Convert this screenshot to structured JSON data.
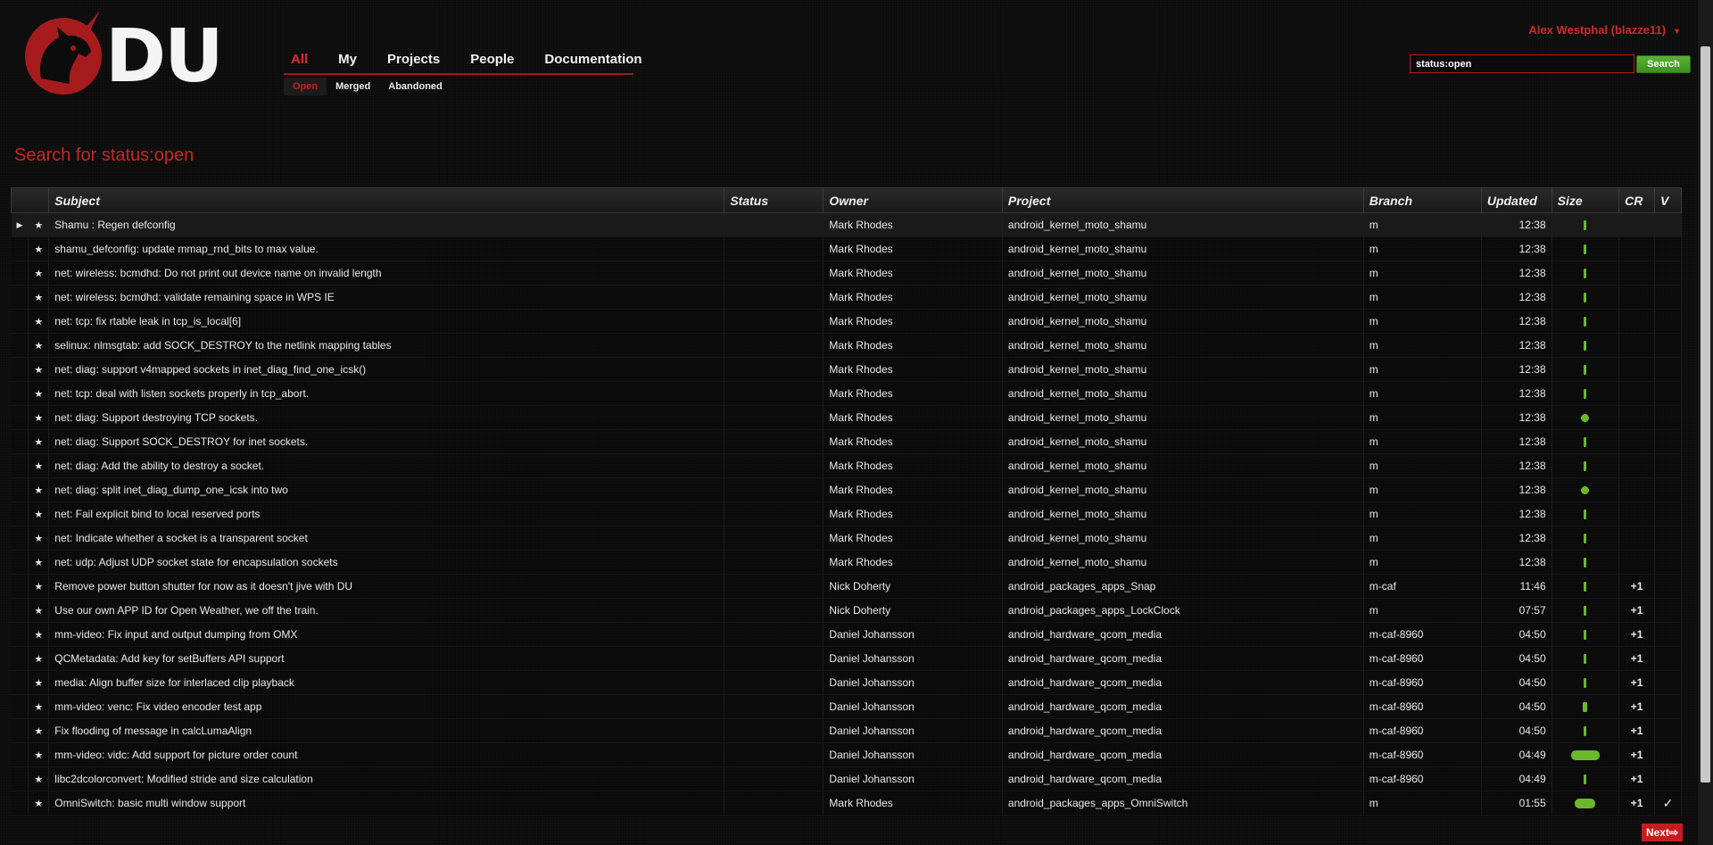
{
  "logo": {
    "text": "DU"
  },
  "nav": {
    "tabs": [
      {
        "label": "All",
        "active": true
      },
      {
        "label": "My",
        "active": false
      },
      {
        "label": "Projects",
        "active": false
      },
      {
        "label": "People",
        "active": false
      },
      {
        "label": "Documentation",
        "active": false
      }
    ],
    "sub": [
      {
        "label": "Open",
        "active": true
      },
      {
        "label": "Merged",
        "active": false
      },
      {
        "label": "Abandoned",
        "active": false
      }
    ]
  },
  "user": {
    "name": "Alex Westphal (blazze11)"
  },
  "search": {
    "value": "status:open",
    "button": "Search"
  },
  "page_title": "Search for status:open",
  "columns": [
    "Subject",
    "Status",
    "Owner",
    "Project",
    "Branch",
    "Updated",
    "Size",
    "CR",
    "V"
  ],
  "rows": [
    {
      "subject": "Shamu : Regen defconfig",
      "status": "",
      "owner": "Mark Rhodes",
      "project": "android_kernel_moto_shamu",
      "branch": "m",
      "updated": "12:38",
      "size": "tiny",
      "cr": "",
      "v": ""
    },
    {
      "subject": "shamu_defconfig: update mmap_rnd_bits to max value.",
      "status": "",
      "owner": "Mark Rhodes",
      "project": "android_kernel_moto_shamu",
      "branch": "m",
      "updated": "12:38",
      "size": "tiny",
      "cr": "",
      "v": ""
    },
    {
      "subject": "net: wireless: bcmdhd: Do not print out device name on invalid length",
      "status": "",
      "owner": "Mark Rhodes",
      "project": "android_kernel_moto_shamu",
      "branch": "m",
      "updated": "12:38",
      "size": "tiny",
      "cr": "",
      "v": ""
    },
    {
      "subject": "net: wireless: bcmdhd: validate remaining space in WPS IE",
      "status": "",
      "owner": "Mark Rhodes",
      "project": "android_kernel_moto_shamu",
      "branch": "m",
      "updated": "12:38",
      "size": "tiny",
      "cr": "",
      "v": ""
    },
    {
      "subject": "net: tcp: fix rtable leak in tcp_is_local[6]",
      "status": "",
      "owner": "Mark Rhodes",
      "project": "android_kernel_moto_shamu",
      "branch": "m",
      "updated": "12:38",
      "size": "tiny",
      "cr": "",
      "v": ""
    },
    {
      "subject": "selinux: nlmsgtab: add SOCK_DESTROY to the netlink mapping tables",
      "status": "",
      "owner": "Mark Rhodes",
      "project": "android_kernel_moto_shamu",
      "branch": "m",
      "updated": "12:38",
      "size": "tiny",
      "cr": "",
      "v": ""
    },
    {
      "subject": "net: diag: support v4mapped sockets in inet_diag_find_one_icsk()",
      "status": "",
      "owner": "Mark Rhodes",
      "project": "android_kernel_moto_shamu",
      "branch": "m",
      "updated": "12:38",
      "size": "tiny",
      "cr": "",
      "v": ""
    },
    {
      "subject": "net: tcp: deal with listen sockets properly in tcp_abort.",
      "status": "",
      "owner": "Mark Rhodes",
      "project": "android_kernel_moto_shamu",
      "branch": "m",
      "updated": "12:38",
      "size": "tiny",
      "cr": "",
      "v": ""
    },
    {
      "subject": "net: diag: Support destroying TCP sockets.",
      "status": "",
      "owner": "Mark Rhodes",
      "project": "android_kernel_moto_shamu",
      "branch": "m",
      "updated": "12:38",
      "size": "dot",
      "cr": "",
      "v": ""
    },
    {
      "subject": "net: diag: Support SOCK_DESTROY for inet sockets.",
      "status": "",
      "owner": "Mark Rhodes",
      "project": "android_kernel_moto_shamu",
      "branch": "m",
      "updated": "12:38",
      "size": "tiny",
      "cr": "",
      "v": ""
    },
    {
      "subject": "net: diag: Add the ability to destroy a socket.",
      "status": "",
      "owner": "Mark Rhodes",
      "project": "android_kernel_moto_shamu",
      "branch": "m",
      "updated": "12:38",
      "size": "tiny",
      "cr": "",
      "v": ""
    },
    {
      "subject": "net: diag: split inet_diag_dump_one_icsk into two",
      "status": "",
      "owner": "Mark Rhodes",
      "project": "android_kernel_moto_shamu",
      "branch": "m",
      "updated": "12:38",
      "size": "dot",
      "cr": "",
      "v": ""
    },
    {
      "subject": "net: Fail explicit bind to local reserved ports",
      "status": "",
      "owner": "Mark Rhodes",
      "project": "android_kernel_moto_shamu",
      "branch": "m",
      "updated": "12:38",
      "size": "tiny",
      "cr": "",
      "v": ""
    },
    {
      "subject": "net: Indicate whether a socket is a transparent socket",
      "status": "",
      "owner": "Mark Rhodes",
      "project": "android_kernel_moto_shamu",
      "branch": "m",
      "updated": "12:38",
      "size": "tiny",
      "cr": "",
      "v": ""
    },
    {
      "subject": "net: udp: Adjust UDP socket state for encapsulation sockets",
      "status": "",
      "owner": "Mark Rhodes",
      "project": "android_kernel_moto_shamu",
      "branch": "m",
      "updated": "12:38",
      "size": "tiny",
      "cr": "",
      "v": ""
    },
    {
      "subject": "Remove power button shutter for now as it doesn't jive with DU",
      "status": "",
      "owner": "Nick Doherty",
      "project": "android_packages_apps_Snap",
      "branch": "m-caf",
      "updated": "11:46",
      "size": "tiny",
      "cr": "+1",
      "v": ""
    },
    {
      "subject": "Use our own APP ID for Open Weather, we off the train.",
      "status": "",
      "owner": "Nick Doherty",
      "project": "android_packages_apps_LockClock",
      "branch": "m",
      "updated": "07:57",
      "size": "tiny",
      "cr": "+1",
      "v": ""
    },
    {
      "subject": "mm-video: Fix input and output dumping from OMX",
      "status": "",
      "owner": "Daniel Johansson",
      "project": "android_hardware_qcom_media",
      "branch": "m-caf-8960",
      "updated": "04:50",
      "size": "tiny",
      "cr": "+1",
      "v": ""
    },
    {
      "subject": "QCMetadata: Add key for setBuffers API support",
      "status": "",
      "owner": "Daniel Johansson",
      "project": "android_hardware_qcom_media",
      "branch": "m-caf-8960",
      "updated": "04:50",
      "size": "tiny",
      "cr": "+1",
      "v": ""
    },
    {
      "subject": "media: Align buffer size for interlaced clip playback",
      "status": "",
      "owner": "Daniel Johansson",
      "project": "android_hardware_qcom_media",
      "branch": "m-caf-8960",
      "updated": "04:50",
      "size": "tiny",
      "cr": "+1",
      "v": ""
    },
    {
      "subject": "mm-video: venc: Fix video encoder test app",
      "status": "",
      "owner": "Daniel Johansson",
      "project": "android_hardware_qcom_media",
      "branch": "m-caf-8960",
      "updated": "04:50",
      "size": "small",
      "cr": "+1",
      "v": ""
    },
    {
      "subject": "Fix flooding of message in calcLumaAlign",
      "status": "",
      "owner": "Daniel Johansson",
      "project": "android_hardware_qcom_media",
      "branch": "m-caf-8960",
      "updated": "04:50",
      "size": "tiny",
      "cr": "+1",
      "v": ""
    },
    {
      "subject": "mm-video: vidc: Add support for picture order count",
      "status": "",
      "owner": "Daniel Johansson",
      "project": "android_hardware_qcom_media",
      "branch": "m-caf-8960",
      "updated": "04:49",
      "size": "large",
      "cr": "+1",
      "v": ""
    },
    {
      "subject": "libc2dcolorconvert: Modified stride and size calculation",
      "status": "",
      "owner": "Daniel Johansson",
      "project": "android_hardware_qcom_media",
      "branch": "m-caf-8960",
      "updated": "04:49",
      "size": "tiny",
      "cr": "+1",
      "v": ""
    },
    {
      "subject": "OmniSwitch: basic multi window support",
      "status": "",
      "owner": "Mark Rhodes",
      "project": "android_packages_apps_OmniSwitch",
      "branch": "m",
      "updated": "01:55",
      "size": "medium",
      "cr": "+1",
      "v": "✓"
    }
  ],
  "pagination": {
    "next": "Next⇨"
  }
}
